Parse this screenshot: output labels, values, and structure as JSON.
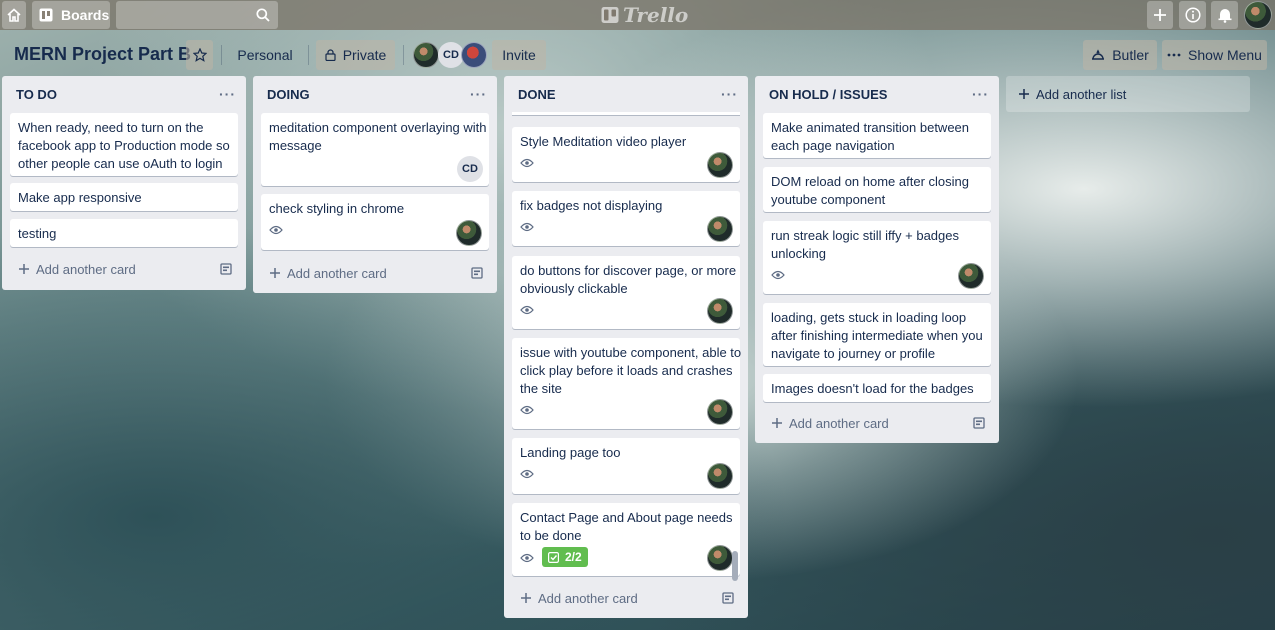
{
  "app": {
    "logo_text": "Trello"
  },
  "topbar": {
    "boards_label": "Boards",
    "search_value": "",
    "icons": [
      "home-icon",
      "boards-icon",
      "search-icon",
      "add-icon",
      "info-icon",
      "bell-icon"
    ]
  },
  "board": {
    "title": "MERN Project Part B",
    "team_label": "Personal",
    "visibility_label": "Private",
    "member_initials": "CD",
    "invite_label": "Invite",
    "butler_label": "Butler",
    "show_menu_label": "Show Menu"
  },
  "lists": [
    {
      "title": "TO DO",
      "cards": [
        {
          "text": "When ready, need to turn on the facebook app to Production mode so other people can use oAuth to login"
        },
        {
          "text": "Make app responsive"
        },
        {
          "text": "testing"
        }
      ],
      "add_card_label": "Add another card"
    },
    {
      "title": "DOING",
      "cards": [
        {
          "text": "meditation component overlaying with message",
          "member": "CD"
        },
        {
          "text": "check styling in chrome"
        }
      ],
      "add_card_label": "Add another card"
    },
    {
      "title": "DONE",
      "cards": [
        {
          "text": "Style Meditation video player"
        },
        {
          "text": "fix badges not displaying"
        },
        {
          "text": "do buttons for discover page, or more obviously clickable"
        },
        {
          "text": "issue with youtube component, able to click play before it loads and crashes the site"
        },
        {
          "text": "Landing page too"
        },
        {
          "text": "Contact Page and About page needs to be done",
          "checklist": "2/2"
        }
      ],
      "add_card_label": "Add another card"
    },
    {
      "title": "ON HOLD / ISSUES",
      "cards": [
        {
          "text": "Make animated transition between each page navigation"
        },
        {
          "text": "DOM reload on home after closing youtube component"
        },
        {
          "text": "run streak logic still iffy + badges unlocking"
        },
        {
          "text": "loading, gets stuck in loading loop after finishing intermediate when you navigate to journey or profile"
        },
        {
          "text": "Images doesn't load for the badges"
        }
      ],
      "add_card_label": "Add another card"
    }
  ],
  "add_list_label": "Add another list",
  "colors": {
    "checklist_complete": "#61bd4f",
    "list_bg": "#ebecf0",
    "text": "#172b4d"
  }
}
